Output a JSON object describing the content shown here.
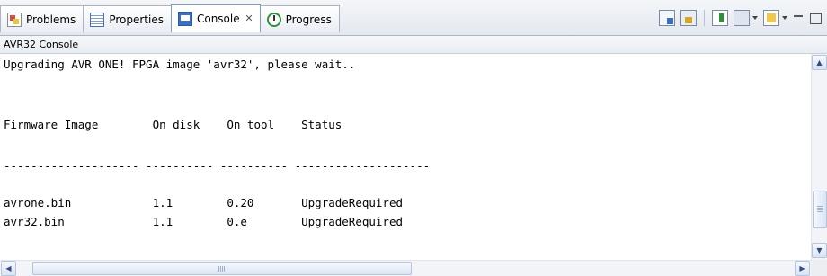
{
  "tabs": [
    {
      "label": "Problems",
      "icon": "problems-icon"
    },
    {
      "label": "Properties",
      "icon": "properties-icon"
    },
    {
      "label": "Console",
      "icon": "console-icon",
      "active": true
    },
    {
      "label": "Progress",
      "icon": "progress-icon"
    }
  ],
  "console_name": "AVR32 Console",
  "output_lines": [
    "Upgrading AVR ONE! FPGA image 'avr32', please wait..",
    "",
    "",
    "",
    "Firmware Image        On disk    On tool    Status",
    "",
    "",
    "-------------------- ---------- ---------- --------------------",
    "",
    "",
    "avrone.bin            1.1        0.20       UpgradeRequired",
    "avr32.bin             1.1        0.e        UpgradeRequired"
  ],
  "toolbar": [
    "clear-console-icon",
    "scroll-lock-icon",
    "pin-console-icon",
    "display-console-icon",
    "open-console-icon",
    "minimize-icon",
    "maximize-icon"
  ],
  "colors": {
    "tab_border": "#aab4c4",
    "scroll_arrow": "#2a4d8c",
    "active_tab_border": "#7f9db9"
  }
}
